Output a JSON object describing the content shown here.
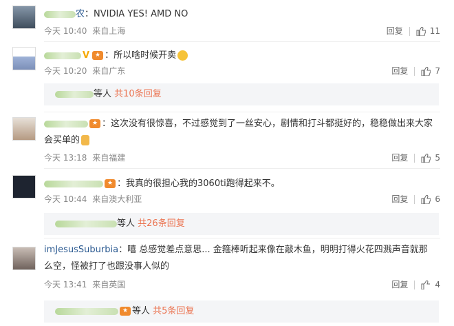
{
  "comments": [
    {
      "text": "：NVIDIA YES! AMD NO",
      "name_prefix": "",
      "name_suffix": "农",
      "time": "今天 10:40",
      "location": "来自上海",
      "reply_label": "回复",
      "likes": "11",
      "avatar_color": "#5a6c7e"
    },
    {
      "text": "：所以啥时候开卖",
      "time": "今天 10:20",
      "location": "来自广东",
      "reply_label": "回复",
      "likes": "7",
      "avatar_color": "#7c8fb8"
    },
    {
      "text": "：这次没有很惊喜，不过感觉到了一丝安心，剧情和打斗都挺好的，稳稳做出来大家会买单的",
      "time": "今天 13:18",
      "location": "来自福建",
      "reply_label": "回复",
      "likes": "5",
      "avatar_color": "#b59a82"
    },
    {
      "text": "：我真的很担心我的3060ti跑得起来不。",
      "time": "今天 10:44",
      "location": "来自澳大利亚",
      "reply_label": "回复",
      "likes": "6",
      "avatar_color": "#1e2430"
    },
    {
      "username": "imJesusSuburbia",
      "text": "：嘻 总感觉差点意思... 金箍棒听起来像在敲木鱼，明明打得火花四溅声音就那么空，怪被打了也跟没事人似的",
      "time": "今天 13:41",
      "location": "来自英国",
      "reply_label": "回复",
      "likes": "4",
      "avatar_color": "#8a7a72"
    }
  ],
  "reply_summaries": [
    {
      "people": "等人",
      "more": "共10条回复"
    },
    {
      "people": "等人",
      "more": "共26条回复"
    },
    {
      "people": "等人",
      "more": "共5条回复"
    }
  ]
}
